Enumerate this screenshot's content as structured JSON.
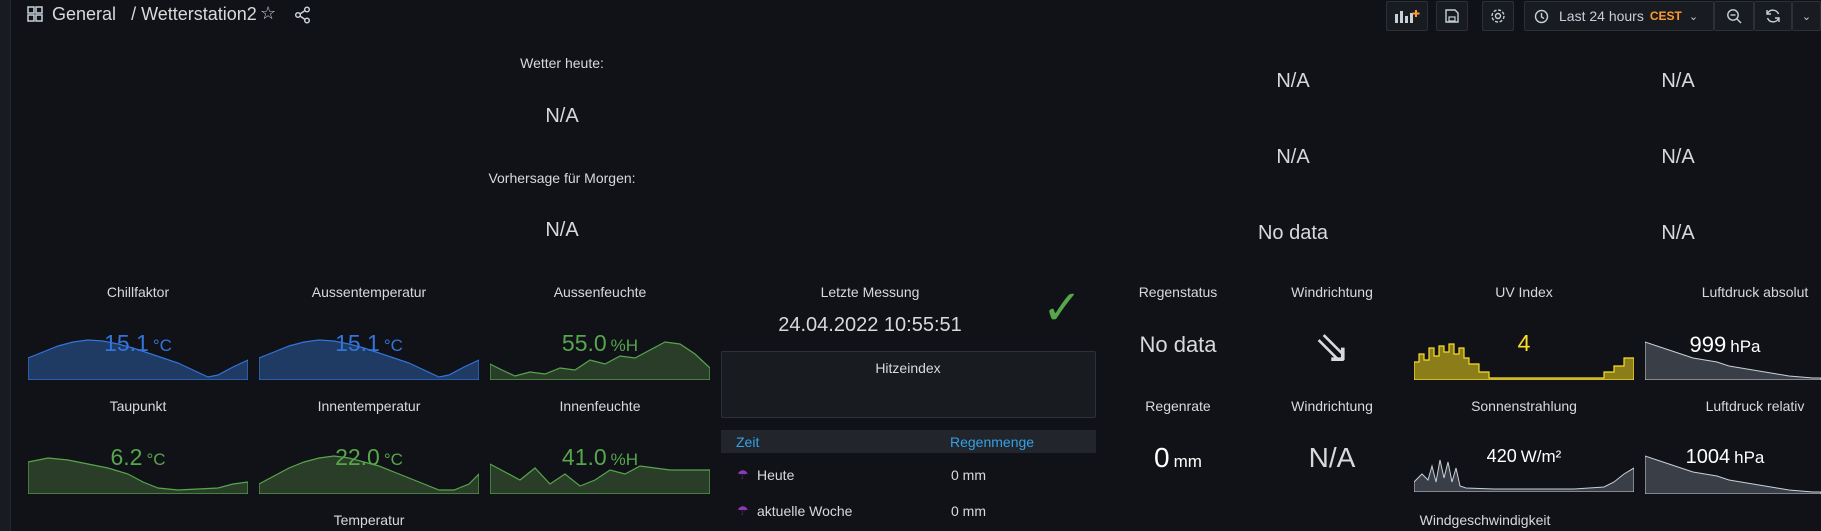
{
  "header": {
    "folder": "General",
    "separator": "/",
    "dashboard": "Wetterstation2",
    "time_range": "Last 24 hours",
    "timezone": "CEST"
  },
  "colors": {
    "blue": "#3274d9",
    "green": "#56a64b",
    "yellow": "#fade2a",
    "grey": "#c7d0d9",
    "white": "#d8d9da"
  },
  "top_left": {
    "wetter_heute_label": "Wetter heute:",
    "wetter_heute_value": "N/A",
    "vorhersage_label": "Vorhersage für Morgen:",
    "vorhersage_value": "N/A"
  },
  "top_right": {
    "col1": [
      "N/A",
      "N/A",
      "No data"
    ],
    "col2": [
      "N/A",
      "N/A",
      "N/A"
    ]
  },
  "panels": {
    "chillfaktor": {
      "title": "Chillfaktor",
      "value": "15.1",
      "unit": "°C"
    },
    "aussentemperatur": {
      "title": "Aussentemperatur",
      "value": "15.1",
      "unit": "°C"
    },
    "aussenfeuchte": {
      "title": "Aussenfeuchte",
      "value": "55.0",
      "unit": "%H"
    },
    "taupunkt": {
      "title": "Taupunkt",
      "value": "6.2",
      "unit": "°C"
    },
    "innentemperatur": {
      "title": "Innentemperatur",
      "value": "22.0",
      "unit": "°C"
    },
    "innenfeuchte": {
      "title": "Innenfeuchte",
      "value": "41.0",
      "unit": "%H"
    },
    "temperatur": {
      "title": "Temperatur"
    },
    "letzte_messung": {
      "title": "Letzte Messung",
      "value": "24.04.2022 10:55:51",
      "check": "✓"
    },
    "hitzeindex": {
      "title": "Hitzeindex"
    },
    "regen_table": {
      "col_zeit": "Zeit",
      "col_regenmenge": "Regenmenge",
      "rows": [
        {
          "zeit": "Heute",
          "menge": "0 mm"
        },
        {
          "zeit": "aktuelle Woche",
          "menge": "0 mm"
        }
      ]
    },
    "regenstatus": {
      "title": "Regenstatus",
      "value": "No data"
    },
    "windrichtung1": {
      "title": "Windrichtung",
      "arrow": "⇘"
    },
    "uv_index": {
      "title": "UV Index",
      "value": "4"
    },
    "luftdruck_absolut": {
      "title": "Luftdruck absolut",
      "value": "999",
      "unit": "hPa"
    },
    "regenrate": {
      "title": "Regenrate",
      "value": "0",
      "unit": "mm"
    },
    "windrichtung2": {
      "title": "Windrichtung",
      "value": "N/A"
    },
    "sonnenstrahlung": {
      "title": "Sonnenstrahlung",
      "value": "420",
      "unit": "W/m²"
    },
    "luftdruck_relativ": {
      "title": "Luftdruck relativ",
      "value": "1004",
      "unit": "hPa"
    },
    "windgeschwindigkeit": {
      "title": "Windgeschwindigkeit"
    }
  }
}
